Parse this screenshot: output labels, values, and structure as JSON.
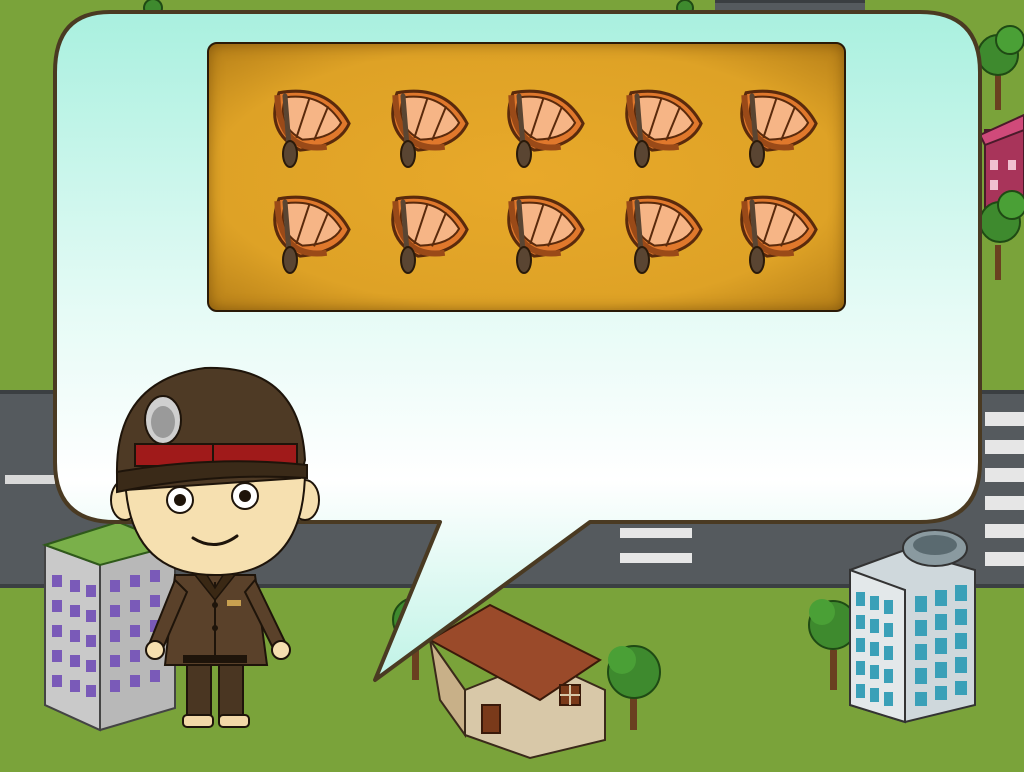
{
  "scene": {
    "description_free": true,
    "colors": {
      "grass": "#7aa33a",
      "road": "#555a5e",
      "bubble_fill_top": "#c8f5ea",
      "bubble_fill_bottom": "#ffffff",
      "bubble_border": "#4a3a22",
      "board_fill": "#e0a326",
      "board_border": "#2a1a08",
      "boat_hull": "#e0782c",
      "boat_inner": "#f6b586",
      "boat_outline": "#5a2a0c",
      "oar": "#5a4532"
    }
  },
  "board": {
    "item_icon": "rowboat-with-oar-icon",
    "rows": 2,
    "columns": 5,
    "item_count": 10
  },
  "characters": {
    "guide": {
      "icon": "police-officer-icon"
    }
  },
  "buildings": [
    {
      "icon": "apartment-tower-icon"
    },
    {
      "icon": "house-icon"
    },
    {
      "icon": "glass-office-tower-icon"
    },
    {
      "icon": "pink-building-icon"
    }
  ],
  "trees": [
    {
      "icon": "tree-icon"
    }
  ]
}
